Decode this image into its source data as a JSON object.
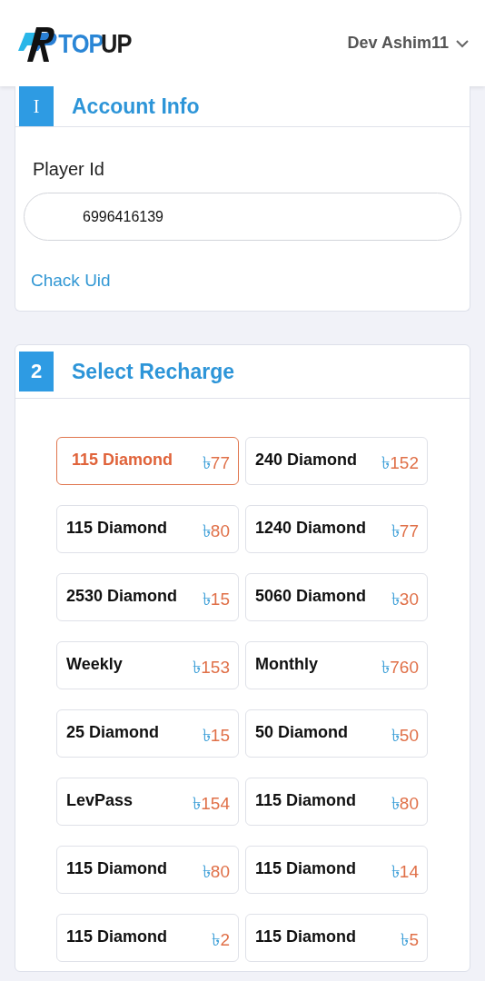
{
  "header": {
    "logo_text_1": "TOP",
    "logo_text_2": "UP",
    "user": "Dev Ashim11"
  },
  "account_info": {
    "step": "I",
    "title": "Account Info",
    "field_label": "Player Id",
    "player_id": "6996416139",
    "link": "Chack Uid"
  },
  "select_recharge": {
    "step": "2",
    "title": "Select Recharge",
    "items": [
      {
        "name": "115 Diamond",
        "currency": "৳",
        "price": "77",
        "selected": true
      },
      {
        "name": "240 Diamond",
        "currency": "৳",
        "price": "152",
        "selected": false
      },
      {
        "name": "115 Diamond",
        "currency": "৳",
        "price": "80",
        "selected": false
      },
      {
        "name": "1240 Diamond",
        "currency": "৳",
        "price": "77",
        "selected": false
      },
      {
        "name": "2530 Diamond",
        "currency": "৳",
        "price": "15",
        "selected": false
      },
      {
        "name": "5060 Diamond",
        "currency": "৳",
        "price": "30",
        "selected": false
      },
      {
        "name": "Weekly",
        "currency": "৳",
        "price": "153",
        "selected": false
      },
      {
        "name": "Monthly",
        "currency": "৳",
        "price": "760",
        "selected": false
      },
      {
        "name": "25 Diamond",
        "currency": "৳",
        "price": "15",
        "selected": false
      },
      {
        "name": "50 Diamond",
        "currency": "৳",
        "price": "50",
        "selected": false
      },
      {
        "name": "LevPass",
        "currency": "৳",
        "price": "154",
        "selected": false
      },
      {
        "name": "115 Diamond",
        "currency": "৳",
        "price": "80",
        "selected": false
      },
      {
        "name": "115 Diamond",
        "currency": "৳",
        "price": "80",
        "selected": false
      },
      {
        "name": "115 Diamond",
        "currency": "৳",
        "price": "14",
        "selected": false
      },
      {
        "name": "115 Diamond",
        "currency": "৳",
        "price": "2",
        "selected": false
      },
      {
        "name": "115 Diamond",
        "currency": "৳",
        "price": "5",
        "selected": false
      }
    ]
  }
}
